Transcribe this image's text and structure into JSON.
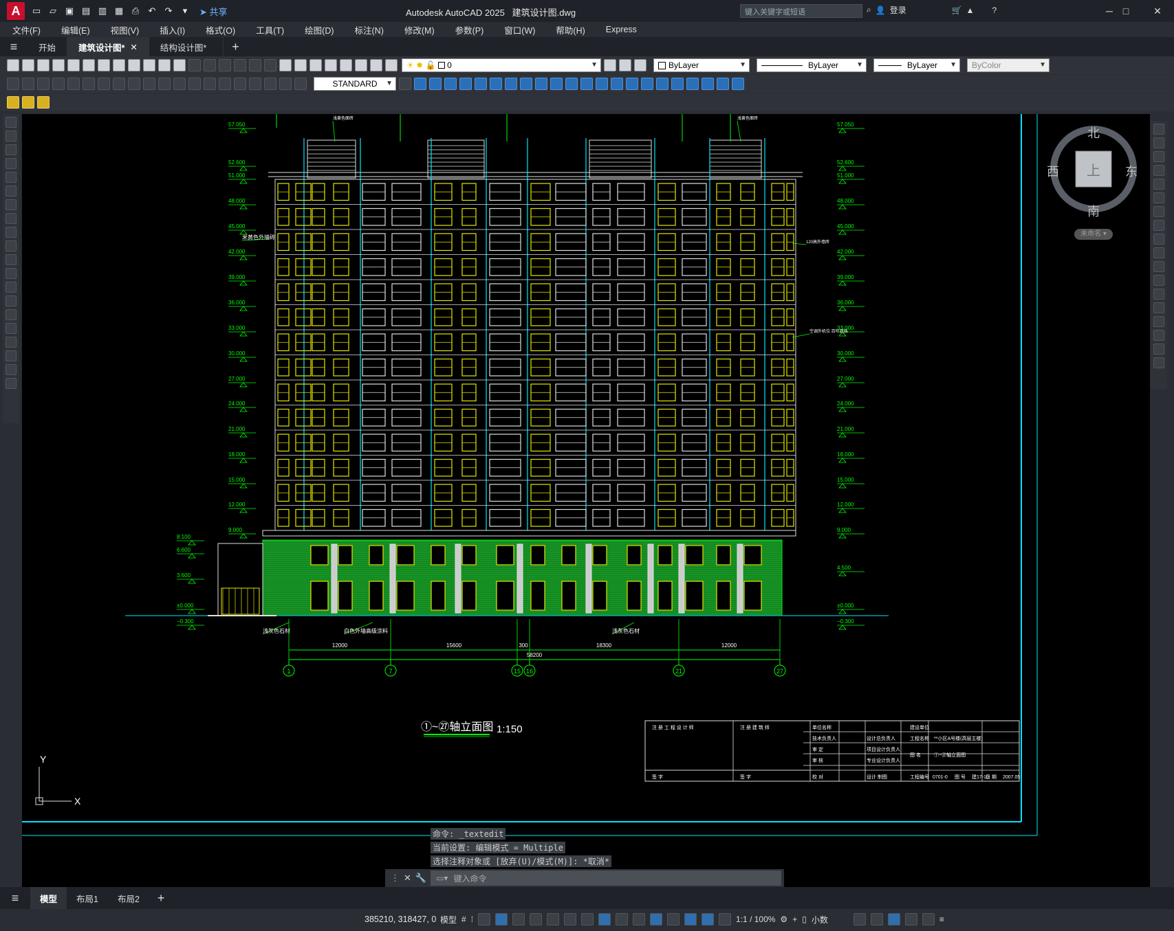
{
  "app": {
    "title": "Autodesk AutoCAD 2025",
    "file": "建筑设计图.dwg",
    "share": "共享",
    "search_placeholder": "键入关键字或短语",
    "login": "登录",
    "logo": "A"
  },
  "menu": [
    "文件(F)",
    "编辑(E)",
    "视图(V)",
    "插入(I)",
    "格式(O)",
    "工具(T)",
    "绘图(D)",
    "标注(N)",
    "修改(M)",
    "参数(P)",
    "窗口(W)",
    "帮助(H)",
    "Express"
  ],
  "doc_tabs": [
    {
      "label": "开始"
    },
    {
      "label": "建筑设计图*",
      "active": true
    },
    {
      "label": "结构设计图*"
    }
  ],
  "toolbar": {
    "layer_value": "0",
    "color": "ByLayer",
    "linetype": "ByLayer",
    "lineweight": "ByLayer",
    "plotstyle": "ByColor",
    "textstyle": "STANDARD"
  },
  "viewcube": {
    "north": "北",
    "south": "南",
    "west": "西",
    "east": "东",
    "top": "上",
    "wcs": "未命名"
  },
  "drawing": {
    "title_prefix": "①~㉗轴立面图",
    "scale": "1:150",
    "levels_left": [
      "57.050",
      "52.600",
      "51.000",
      "48.000",
      "45.000",
      "42.000",
      "39.000",
      "36.000",
      "33.000",
      "30.000",
      "27.000",
      "24.000",
      "21.000",
      "18.000",
      "15.000",
      "12.000",
      "9.000",
      "8.100",
      "6.600",
      "3.600",
      "±0.000",
      "−0.300"
    ],
    "levels_right": [
      "57.050",
      "52.600",
      "51.000",
      "48.000",
      "45.000",
      "42.000",
      "39.000",
      "36.000",
      "33.000",
      "30.000",
      "27.000",
      "24.000",
      "21.000",
      "18.000",
      "15.000",
      "12.000",
      "9.000",
      "4.500",
      "±0.000",
      "−0.300"
    ],
    "dims": [
      "12000",
      "15600",
      "300",
      "18300",
      "12000"
    ],
    "total_dim": "58200",
    "axes": [
      "1",
      "7",
      "15",
      "16",
      "21",
      "27"
    ],
    "notes": [
      "米黄色外墙砖",
      "浅灰色石材",
      "白色外墙高级涂料",
      "浅灰色石材",
      "120高外墙砖",
      "空调外机位 百叶遮挡",
      "浅黄色面砖",
      "浅黄色面砖"
    ],
    "title_block": {
      "r1": [
        "注 册 工 程 设 计 师",
        "注 册 建 筑 师",
        "单位名称",
        "",
        "建设单位",
        ""
      ],
      "r2": [
        "技术负责人",
        "",
        "设计总负责人",
        "",
        "工程名称",
        "**小区A号楼(高层主楼)"
      ],
      "r3": [
        "审  定",
        "",
        "项目设计负责人",
        "",
        "图  名",
        "①~㉗轴立面图"
      ],
      "r4": [
        "审  核",
        "",
        "专业设计负责人",
        ""
      ],
      "r5": [
        "签 字",
        "签 字",
        "校  对",
        "",
        "设计  制图",
        "",
        "工程编号",
        "0701-0",
        "图  号",
        "建17-10",
        "日  期",
        "2007.05"
      ]
    }
  },
  "command": {
    "history": [
      "命令: _textedit",
      "当前设置: 编辑模式 = Multiple",
      "选择注释对象或 [放弃(U)/模式(M)]: *取消*"
    ],
    "placeholder": "键入命令"
  },
  "layout_tabs": [
    {
      "label": "模型",
      "active": true
    },
    {
      "label": "布局1"
    },
    {
      "label": "布局2"
    }
  ],
  "status": {
    "coords": "385210, 318427, 0",
    "mode": "模型",
    "scale": "1:1 / 100%",
    "units": "小数"
  },
  "colors": {
    "building_white": "#e0e0e0",
    "window_yellow": "#e6e600",
    "cyan": "#00e5ff",
    "green": "#00ff00",
    "base_green": "#1a9a2a"
  }
}
